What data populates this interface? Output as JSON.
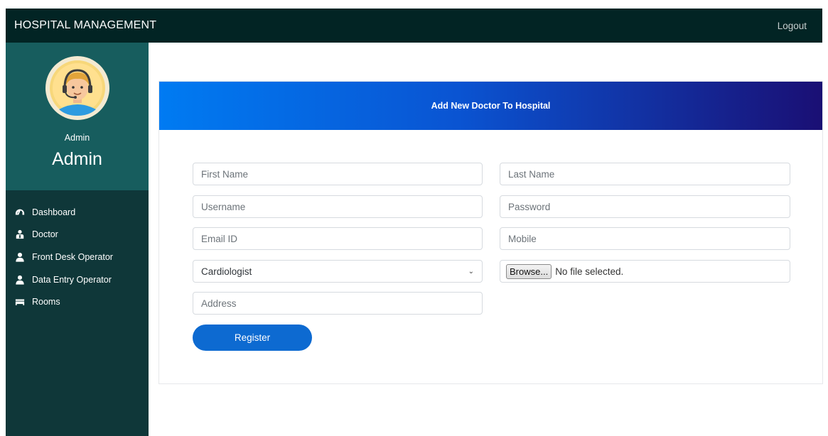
{
  "navbar": {
    "brand": "HOSPITAL MANAGEMENT",
    "logout": "Logout"
  },
  "sidebar": {
    "role": "Admin",
    "username": "Admin",
    "items": [
      {
        "label": "Dashboard",
        "icon": "dashboard-gauge-icon"
      },
      {
        "label": "Doctor",
        "icon": "doctor-icon"
      },
      {
        "label": "Front Desk Operator",
        "icon": "user-icon"
      },
      {
        "label": "Data Entry Operator",
        "icon": "user-icon"
      },
      {
        "label": "Rooms",
        "icon": "bed-icon"
      }
    ]
  },
  "form": {
    "title": "Add New Doctor To Hospital",
    "first_name_placeholder": "First Name",
    "last_name_placeholder": "Last Name",
    "username_placeholder": "Username",
    "password_placeholder": "Password",
    "email_placeholder": "Email ID",
    "mobile_placeholder": "Mobile",
    "specialization_selected": "Cardiologist",
    "browse_label": "Browse...",
    "file_status": "No file selected.",
    "address_placeholder": "Address",
    "register_label": "Register"
  },
  "colors": {
    "navbar_bg": "#022424",
    "sidebar_bg": "#0f3739",
    "profile_bg": "#175d5e",
    "header_gradient_start": "#007bf2",
    "header_gradient_end": "#1a0f74",
    "button_bg": "#0d6ad1"
  }
}
